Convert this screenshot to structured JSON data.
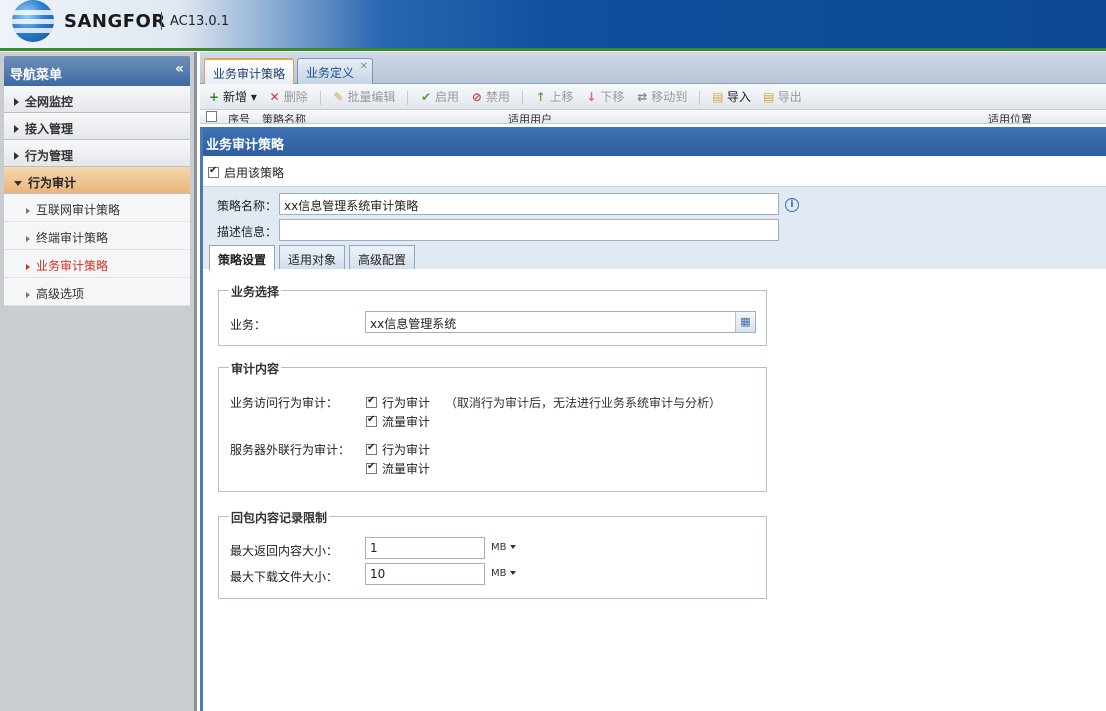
{
  "header": {
    "brand": "SANGFOR",
    "version": "AC13.0.1"
  },
  "nav": {
    "title": "导航菜单",
    "collapse_glyph": "«",
    "groups": [
      {
        "label": "全网监控"
      },
      {
        "label": "接入管理"
      },
      {
        "label": "行为管理"
      },
      {
        "label": "行为审计"
      }
    ],
    "audit_items": [
      {
        "label": "互联网审计策略"
      },
      {
        "label": "终端审计策略"
      },
      {
        "label": "业务审计策略"
      },
      {
        "label": "高级选项"
      }
    ]
  },
  "main_tabs": [
    {
      "label": "业务审计策略"
    },
    {
      "label": "业务定义"
    }
  ],
  "toolbar": {
    "add": "新增",
    "delete": "删除",
    "batch_edit": "批量编辑",
    "enable": "启用",
    "disable": "禁用",
    "move_up": "上移",
    "move_down": "下移",
    "move_to": "移动到",
    "import": "导入",
    "export": "导出"
  },
  "grid_head": {
    "seq": "序号",
    "name": "策略名称",
    "users": "适用用户",
    "location": "适用位置"
  },
  "dialog": {
    "title": "业务审计策略",
    "enable_label": "启用该策略",
    "name_label": "策略名称：",
    "name_value": "xx信息管理系统审计策略",
    "desc_label": "描述信息：",
    "desc_value": "",
    "tabs": [
      {
        "label": "策略设置"
      },
      {
        "label": "适用对象"
      },
      {
        "label": "高级配置"
      }
    ],
    "business_select": {
      "legend": "业务选择",
      "label": "业务：",
      "value": "xx信息管理系统"
    },
    "audit_content": {
      "legend": "审计内容",
      "access_label": "业务访问行为审计：",
      "behavior_audit": "行为审计",
      "traffic_audit": "流量审计",
      "hint": "（取消行为审计后，无法进行业务系统审计与分析）",
      "server_label": "服务器外联行为审计："
    },
    "response_limit": {
      "legend": "回包内容记录限制",
      "max_return_label": "最大返回内容大小：",
      "max_return_value": "1",
      "max_download_label": "最大下载文件大小：",
      "max_download_value": "10",
      "unit": "MB"
    }
  }
}
